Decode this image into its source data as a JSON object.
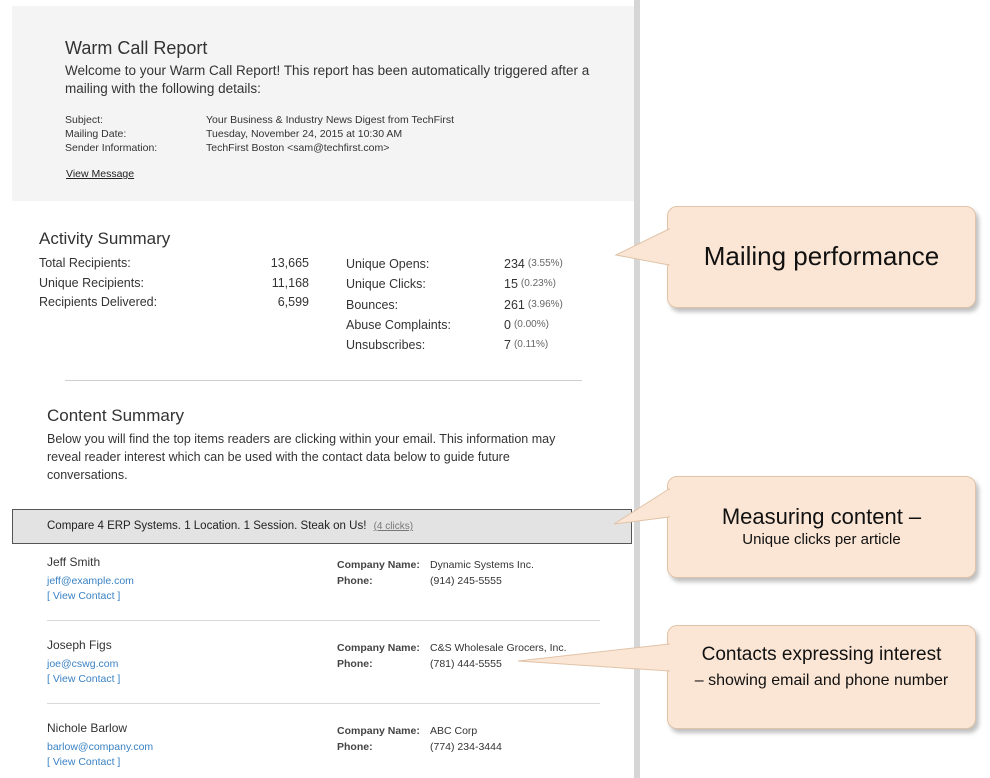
{
  "header": {
    "title": "Warm Call Report",
    "welcome": "Welcome to your Warm Call Report! This report has been automatically triggered after a mailing with the following details:",
    "details": [
      {
        "key": "Subject:",
        "value": "Your Business & Industry News Digest from TechFirst"
      },
      {
        "key": "Mailing Date:",
        "value": "Tuesday, November 24, 2015 at 10:30 AM"
      },
      {
        "key": "Sender Information:",
        "value": "TechFirst Boston <sam@techfirst.com>"
      }
    ],
    "view_message": "View Message"
  },
  "activity": {
    "title": "Activity Summary",
    "left": [
      {
        "label": "Total Recipients:",
        "value": "13,665"
      },
      {
        "label": "Unique Recipients:",
        "value": "11,168"
      },
      {
        "label": "Recipients Delivered:",
        "value": "6,599"
      }
    ],
    "right": [
      {
        "label": "Unique Opens:",
        "value": "234",
        "pct": "(3.55%)"
      },
      {
        "label": "Unique Clicks:",
        "value": "15",
        "pct": "(0.23%)"
      },
      {
        "label": "Bounces:",
        "value": "261",
        "pct": "(3.96%)"
      },
      {
        "label": "Abuse Complaints:",
        "value": "0",
        "pct": "(0.00%)"
      },
      {
        "label": "Unsubscribes:",
        "value": "7",
        "pct": "(0.11%)"
      }
    ]
  },
  "content": {
    "title": "Content Summary",
    "description": "Below you will find the top items readers are clicking within your email. This information may reveal reader interest which can be used with the contact data below to guide future conversations.",
    "article": {
      "title": "Compare 4 ERP Systems. 1 Location. 1 Session. Steak on Us!",
      "clicks": "(4 clicks)"
    },
    "company_label": "Company Name:",
    "phone_label": "Phone:",
    "view_contact": "[ View Contact ]",
    "contacts": [
      {
        "name": "Jeff Smith",
        "email": "jeff@example.com",
        "company": "Dynamic Systems Inc.",
        "phone": "(914) 245-5555"
      },
      {
        "name": "Joseph Figs",
        "email": "joe@cswg.com",
        "company": "C&S Wholesale Grocers, Inc.",
        "phone": "(781) 444-5555"
      },
      {
        "name": "Nichole Barlow",
        "email": "barlow@company.com",
        "company": "ABC Corp",
        "phone": "(774) 234-3444"
      }
    ]
  },
  "callouts": {
    "mailing": "Mailing performance",
    "content_title": "Measuring content –",
    "content_sub": "Unique clicks per article",
    "contacts_title": "Contacts expressing interest",
    "contacts_sub": "– showing email and phone number"
  }
}
